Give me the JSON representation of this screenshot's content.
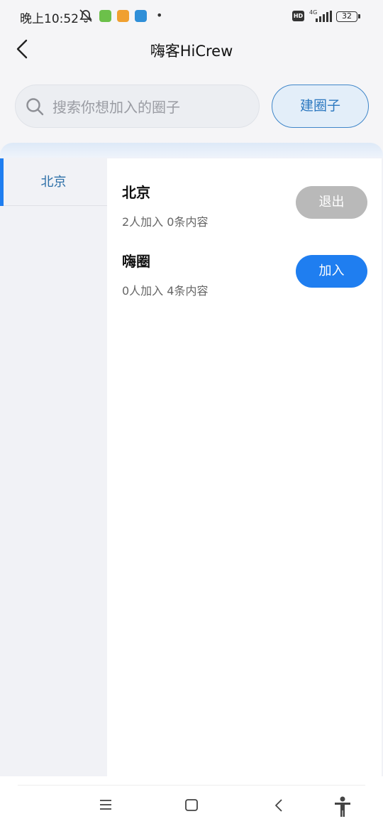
{
  "status_bar": {
    "time": "晚上10:52",
    "hd": "HD",
    "network": "4G",
    "battery": "32"
  },
  "header": {
    "title": "嗨客HiCrew"
  },
  "search": {
    "placeholder": "搜索你想加入的圈子",
    "create_label": "建圈子"
  },
  "categories": [
    {
      "label": "北京"
    }
  ],
  "circles": [
    {
      "name": "北京",
      "stats": "2人加入 0条内容",
      "action": "退出"
    },
    {
      "name": "嗨圈",
      "stats": "0人加入 4条内容",
      "action": "加入"
    }
  ],
  "colors": {
    "accent": "#1f7ef0",
    "quit_button": "#b9b9b9",
    "create_border": "#3f86c9"
  }
}
